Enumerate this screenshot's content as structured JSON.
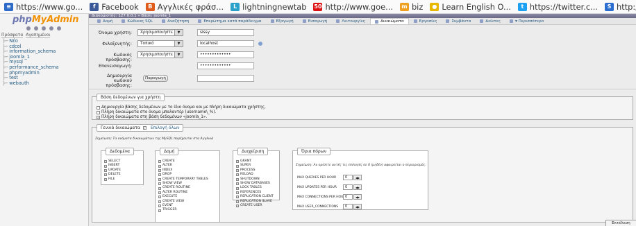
{
  "bookmarks": [
    {
      "label": "https://www.go...",
      "color": "#2f6cc9",
      "glyph": "≡",
      "icon": "web-icon"
    },
    {
      "label": "Facebook",
      "color": "#3b5998",
      "glyph": "f",
      "icon": "facebook-icon"
    },
    {
      "label": "Αγγλικές φράσ...",
      "color": "#e05a1c",
      "glyph": "B",
      "icon": "blogger-icon"
    },
    {
      "label": "lightningnewtab",
      "color": "#2aa1c9",
      "glyph": "L",
      "icon": "lightning-icon"
    },
    {
      "label": "http://www.goe...",
      "color": "#d11",
      "glyph": "50",
      "icon": "goe-icon"
    },
    {
      "label": "biz",
      "color": "#f0a020",
      "glyph": "m",
      "icon": "biz-icon"
    },
    {
      "label": "Learn English O...",
      "color": "#e8b800",
      "glyph": "●",
      "icon": "learn-icon"
    },
    {
      "label": "https://twitter.c...",
      "color": "#1da1f2",
      "glyph": "t",
      "icon": "twitter-icon"
    },
    {
      "label": "http://www.spe...",
      "color": "#2a6fcf",
      "glyph": "S",
      "icon": "spe-icon"
    }
  ],
  "sidebar": {
    "logo_php": "php",
    "logo_my": "MyAdmin",
    "tabs": [
      "Πρόσφατα",
      "Αγαπημένοι"
    ],
    "items": [
      "Νέο",
      "cdcol",
      "information_schema",
      "joomla_1",
      "mysql",
      "performance_schema",
      "phpmyadmin",
      "test",
      "webauth"
    ]
  },
  "breadcrumb": "Διακομιστής: 127.0.0.1 » Βάση: joomla_1",
  "tabs": [
    {
      "label": "Δομή",
      "active": false
    },
    {
      "label": "Κώδικας SQL",
      "active": false
    },
    {
      "label": "Αναζήτηση",
      "active": false
    },
    {
      "label": "Επερώτημα κατά παράδειγμα",
      "active": false
    },
    {
      "label": "Εξαγωγή",
      "active": false
    },
    {
      "label": "Εισαγωγή",
      "active": false
    },
    {
      "label": "Λειτουργίες",
      "active": false
    },
    {
      "label": "Δικαιώματα",
      "active": true
    },
    {
      "label": "Εργασίες",
      "active": false
    },
    {
      "label": "Συμβάντα",
      "active": false
    },
    {
      "label": "Δείκτες",
      "active": false
    },
    {
      "label": "▾ Περισσότερο",
      "active": false
    }
  ],
  "form": {
    "username_label": "Όνομα χρήστη:",
    "username_select": "Χρησιμοποιήστε",
    "username_value": "sissy",
    "host_label": "Φιλοξενητής:",
    "host_select": "Τοπικό",
    "host_value": "localhost",
    "password_label": "Κωδικός πρόσβασης:",
    "password_select": "Χρησιμοποιήστε",
    "password_value": "•••••••••••••",
    "retype_label": "Επανεισαγωγή:",
    "retype_value": "•••••••••••••",
    "generate_label": "Δημιουργία κωδικού πρόσβασης:",
    "generate_button": "Παραγωγή"
  },
  "database": {
    "legend": "Βάση δεδομένων για χρήστη",
    "options": [
      "Δημιουργία βάσης δεδομένων με το ίδιο όνομα και με πλήρη δικαιώματα χρήστης.",
      "Πλήρη δικαιώματα στο όνομα μπαλαντέρ (username\\_%).",
      "Πλήρη δικαιώματα στη βάση δεδομένων «joomla_1»."
    ]
  },
  "global": {
    "legend": "Γενικά δικαιώματα",
    "select_all": "Επιλογή όλων",
    "note": "Σημείωση: Τα ονόματα δικαιωμάτων της MySQL παρέχονται στα Αγγλικά",
    "data": {
      "legend": "Δεδομένα",
      "items": [
        "SELECT",
        "INSERT",
        "UPDATE",
        "DELETE",
        "FILE"
      ]
    },
    "structure": {
      "legend": "Δομή",
      "items": [
        "CREATE",
        "ALTER",
        "INDEX",
        "DROP",
        "CREATE TEMPORARY TABLES",
        "SHOW VIEW",
        "CREATE ROUTINE",
        "ALTER ROUTINE",
        "EXECUTE",
        "CREATE VIEW",
        "EVENT",
        "TRIGGER"
      ]
    },
    "admin": {
      "legend": "Διαχείριση",
      "items": [
        "GRANT",
        "SUPER",
        "PROCESS",
        "RELOAD",
        "SHUTDOWN",
        "SHOW DATABASES",
        "LOCK TABLES",
        "REFERENCES",
        "REPLICATION CLIENT",
        "REPLICATION SLAVE",
        "CREATE USER"
      ]
    },
    "limits": {
      "legend": "Όρια πόρων",
      "note": "Σημείωση: Αν ορίσετε αυτές τις επιλογές σε 0 (μηδέν) αφαιρείται ο περιορισμός.",
      "rows": [
        {
          "label": "MAX QUERIES PER HOUR",
          "value": "0"
        },
        {
          "label": "MAX UPDATES PER HOUR",
          "value": "0"
        },
        {
          "label": "MAX CONNECTIONS PER HOUR",
          "value": "0"
        },
        {
          "label": "MAX USER_CONNECTIONS",
          "value": "0"
        }
      ]
    }
  },
  "go_button": "Εκτέλεση"
}
